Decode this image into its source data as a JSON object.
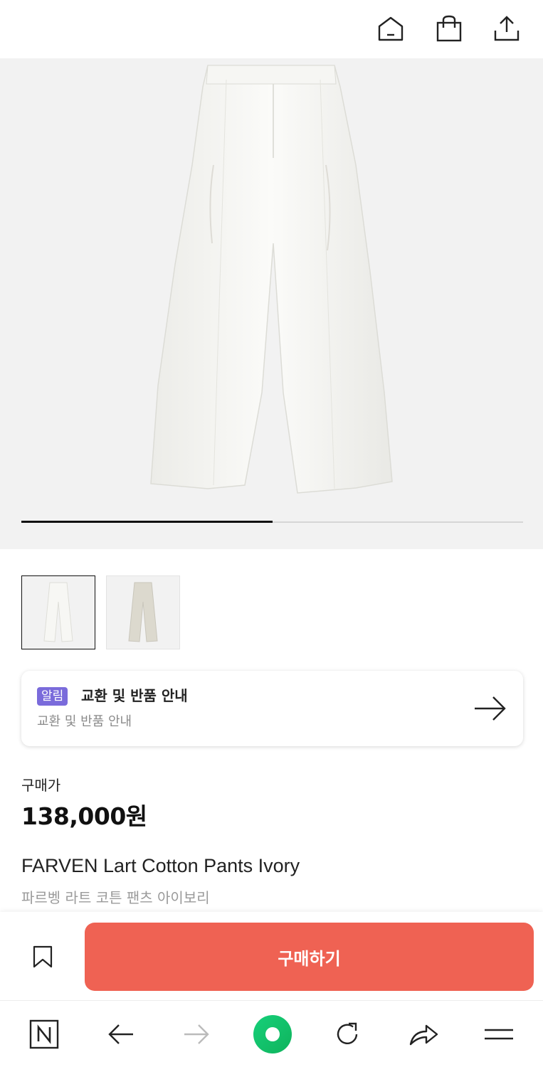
{
  "top_icons": [
    "home-icon",
    "shopping-bag-icon",
    "share-upload-icon"
  ],
  "gallery": {
    "current_page": 1,
    "total_pages": 2,
    "progress_fraction": 0.5,
    "thumbnails": [
      {
        "name": "thumbnail-ivory",
        "color": "#f4f4f0",
        "selected": true
      },
      {
        "name": "thumbnail-beige",
        "color": "#dcd9ce",
        "selected": false
      }
    ]
  },
  "notice": {
    "badge": "알림",
    "title": "교환 및 반품 안내",
    "subtitle": "교환 및 반품 안내"
  },
  "price": {
    "label": "구매가",
    "value": "138,000원"
  },
  "product": {
    "name": "FARVEN Lart Cotton Pants Ivory",
    "name_ko": "파르벵 라트 코튼 팬츠 아이보리"
  },
  "buy_bar": {
    "buy_label": "구매하기",
    "button_color": "#ef6253"
  },
  "browser_nav": [
    "naver-n-icon",
    "back-arrow-icon",
    "forward-arrow-icon",
    "green-home-dot-icon",
    "refresh-icon",
    "share-icon",
    "menu-icon"
  ],
  "colors": {
    "loading_bar": "#1fa83a",
    "badge": "#7a6bdb",
    "green_button": "#19c46b"
  }
}
